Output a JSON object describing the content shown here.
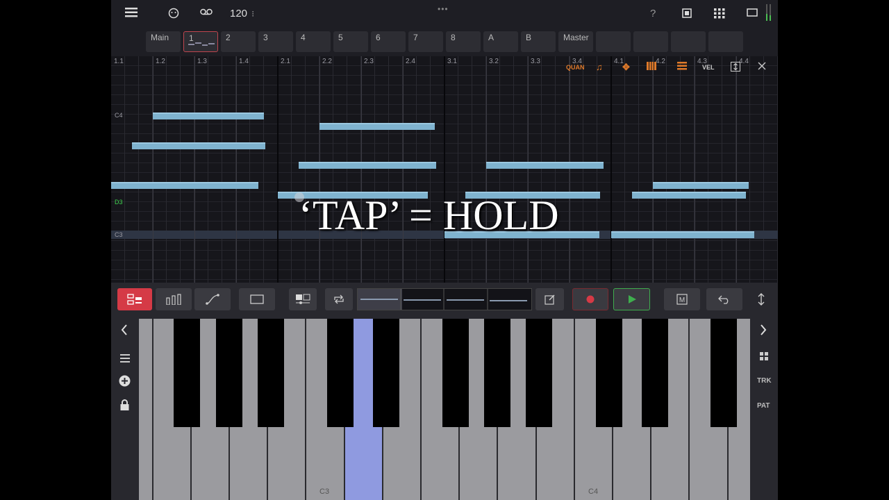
{
  "top_bar": {
    "menu_icon": "hamburger-menu-icon",
    "tempo": "120",
    "tempo_dots": "⁝",
    "window_grip": "•••",
    "help": "?"
  },
  "pattern_slots": [
    {
      "label": "Main"
    },
    {
      "label": "1"
    },
    {
      "label": "2"
    },
    {
      "label": "3"
    },
    {
      "label": "4"
    },
    {
      "label": "5"
    },
    {
      "label": "6"
    },
    {
      "label": "7"
    },
    {
      "label": "8"
    },
    {
      "label": "A"
    },
    {
      "label": "B"
    },
    {
      "label": "Master"
    },
    {
      "label": ""
    },
    {
      "label": ""
    },
    {
      "label": ""
    },
    {
      "label": ""
    }
  ],
  "piano_roll": {
    "ruler": [
      "1.1",
      "1.2",
      "1.3",
      "1.4",
      "2.1",
      "2.2",
      "2.3",
      "2.4",
      "3.1",
      "3.2",
      "3.3",
      "3.4",
      "4.1",
      "4.2",
      "4.3",
      "4.4"
    ],
    "key_labels": {
      "c4": "C4",
      "d3": "D3",
      "c3": "C3"
    },
    "tools": {
      "quantize": "QUAN",
      "velocity": "VEL"
    },
    "overlay_text": "‘TAP’ = HOLD"
  },
  "keyboard": {
    "labels": {
      "c3": "C3",
      "c4": "C4"
    },
    "right_tabs": {
      "track": "TRK",
      "pattern": "PAT"
    }
  },
  "colors": {
    "note": "#7fb3cf",
    "accent_red": "#d53a46",
    "play_green": "#3fae4e",
    "active_key": "#8f9ae0",
    "tool_orange": "#e07a2a"
  }
}
